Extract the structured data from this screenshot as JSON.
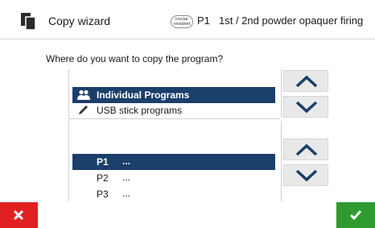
{
  "header": {
    "title": "Copy wizard",
    "logo_text": "ivoclar vivadent",
    "program_code": "P1",
    "program_description": "1st / 2nd powder opaquer firing"
  },
  "question": "Where do you want to copy the program?",
  "sources": [
    {
      "label": "Individual Programs",
      "icon": "users-icon",
      "selected": true
    },
    {
      "label": "USB stick programs",
      "icon": "pen-icon",
      "selected": false
    }
  ],
  "programs": [
    {
      "code": "P1",
      "desc": "...",
      "selected": true
    },
    {
      "code": "P2",
      "desc": "...",
      "selected": false
    },
    {
      "code": "P3",
      "desc": "...",
      "selected": false
    }
  ],
  "colors": {
    "selection": "#1b3f6b",
    "cancel": "#e02020",
    "confirm": "#2f9a2f",
    "arrow": "#1b3f6b"
  }
}
